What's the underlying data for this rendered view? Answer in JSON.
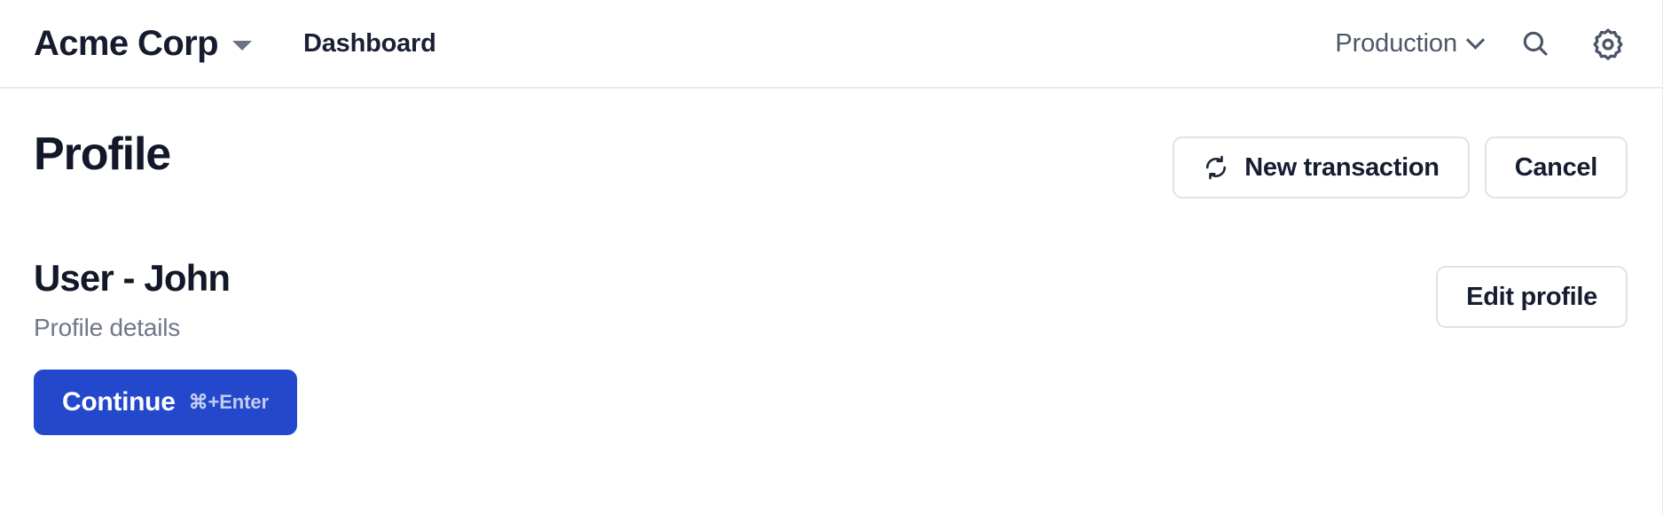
{
  "header": {
    "brand": "Acme Corp",
    "brand_caret_icon": "caret-down-icon",
    "nav_link": "Dashboard",
    "environment": "Production",
    "environment_chevron_icon": "chevron-down-icon",
    "search_icon": "search-icon",
    "settings_icon": "gear-icon"
  },
  "page": {
    "title": "Profile",
    "actions": {
      "new_transaction_label": "New transaction",
      "new_transaction_icon": "refresh-icon",
      "cancel_label": "Cancel"
    }
  },
  "profile": {
    "title": "User - John",
    "subtitle": "Profile details",
    "edit_label": "Edit profile"
  },
  "footer": {
    "continue_label": "Continue",
    "continue_shortcut": "⌘+Enter"
  },
  "colors": {
    "primary": "#2348cc",
    "text": "#121729",
    "muted": "#70778a",
    "border": "#dfe2e9",
    "header_border": "#e8e9ee",
    "shortcut_text": "#c3cdf0"
  }
}
